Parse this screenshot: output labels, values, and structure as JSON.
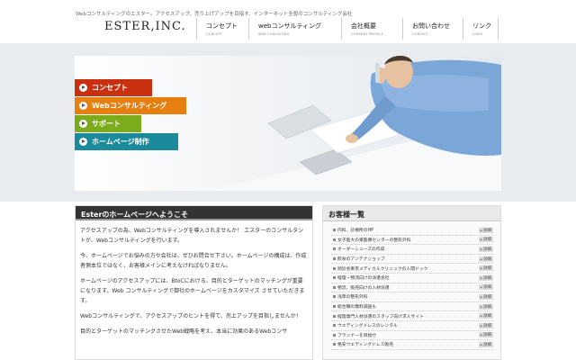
{
  "header": {
    "tagline": "Webコンサルティングのエスター。アクセスアップ、売り上げアップを目指す、インターネット全般のコンサルティング会社",
    "logo": "ESTER,INC."
  },
  "nav": [
    {
      "label": "コンセプト",
      "sub": "CONCEPT"
    },
    {
      "label": "webコンサルティング",
      "sub": "WEB CONSULTING"
    },
    {
      "label": "会社概要",
      "sub": "COMPANY PROFILE"
    },
    {
      "label": "お問い合わせ",
      "sub": "CONTACT"
    },
    {
      "label": "リンク",
      "sub": "LINKS"
    }
  ],
  "hero_menu": [
    {
      "label": "コンセプト",
      "color": "#c8300f"
    },
    {
      "label": "Webコンサルティング",
      "color": "#e67e10"
    },
    {
      "label": "サポート",
      "color": "#7cab1c"
    },
    {
      "label": "ホームページ制作",
      "color": "#1b8a9a"
    }
  ],
  "welcome": {
    "title": "Esterのホームページへようこそ",
    "paragraphs": [
      "アクセスアップの為、Webコンサルティングを導入されませんか！ エスターのコンサルタントが、Webコンサルティングを行います。",
      "今、ホームページでお悩みの方や会社は、ぜひお問合せ下さい。ホームページの構成は、作成者側本位ではなく、お客様メインに考えなければなりません。",
      "ホームページのアクセスアップには、BtoCにおける、目的とターゲットのマッチングが重要になります。Web コンサルティングで御社のホームページをカスタマイズ させていただきます。",
      "Webコンサルティングで、アクセスアップのヒントを得て、売上アップを目指しませんか！",
      "目的とターゲットのマッチングさせたWeb戦略を考え、本当に効果のあるWebコンサ"
    ]
  },
  "clients": {
    "title": "お客様一覧",
    "detail_label": "詳細",
    "items": [
      "内科、診療所のHP",
      "女子医大の東医療センターの整形外科",
      "オーダーシューズの作成",
      "飲食のアンテナショップ",
      "顔診会東京メディカルクリニックの人間ドック",
      "経理・物流向けの派遣会社",
      "物流、販売向けの人材派遣",
      "浅草の整形外科",
      "総合職の無料調査も",
      "経理専門人材派遣のスタッフ向け求人サイト",
      "ウエディングドレスのレンタル",
      "プランナーを目指せ",
      "格安ウエディングドレス販売"
    ]
  }
}
